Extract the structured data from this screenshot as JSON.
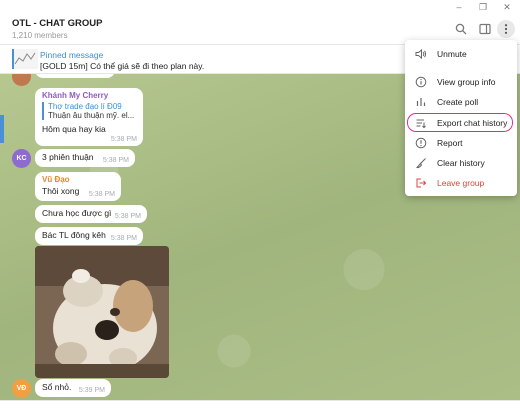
{
  "window": {
    "minimize_glyph": "–",
    "maximize_glyph": "❐",
    "close_glyph": "✕"
  },
  "header": {
    "title": "OTL - CHAT GROUP",
    "members": "1,210 members",
    "icons": [
      "search-icon",
      "sidebar-toggle-icon",
      "more-vertical-icon"
    ]
  },
  "pinned": {
    "label": "Pinned message",
    "text": "[GOLD 15m] Có thể giá sẽ đi theo plan này."
  },
  "messages": [
    {
      "sender": "Khánh My Cherry",
      "sender_color": "#8e5bc7",
      "reply_title": "Thợ trade đạo lí Đ09",
      "reply_text": "Thuận âu thuận mỹ. el...",
      "text": "Hôm qua hay kia",
      "time": "5:38 PM"
    },
    {
      "avatar": "KC",
      "avatar_color": "#8e6bd0",
      "text": "3 phiên thuận",
      "time": "5:38 PM"
    },
    {
      "sender": "Vũ Đạo",
      "sender_color": "#e8862b",
      "text": "Thôi xong",
      "time": "5:38 PM"
    },
    {
      "text": "Chưa học được gì",
      "time": "5:38 PM"
    },
    {
      "text": "Bác TL đông kêh",
      "time": "5:38 PM"
    },
    {
      "avatar": "VĐ",
      "avatar_color": "#f0a040",
      "text": "Sổ nhỏ.",
      "time": "5:39 PM"
    }
  ],
  "menu": {
    "items": [
      {
        "label": "Unmute",
        "icon": "speaker-icon",
        "danger": false
      },
      {
        "label": "View group info",
        "icon": "info-icon",
        "danger": false
      },
      {
        "label": "Create poll",
        "icon": "poll-icon",
        "danger": false
      },
      {
        "label": "Export chat history",
        "icon": "export-icon",
        "danger": false
      },
      {
        "label": "Report",
        "icon": "report-icon",
        "danger": false
      },
      {
        "label": "Clear history",
        "icon": "broom-icon",
        "danger": false
      },
      {
        "label": "Leave group",
        "icon": "leave-icon",
        "danger": true
      }
    ]
  },
  "colors": {
    "accent": "#3b8fd3",
    "highlight": "#e02a8f",
    "chat_background": "#a9bc86",
    "danger": "#e0443a"
  }
}
